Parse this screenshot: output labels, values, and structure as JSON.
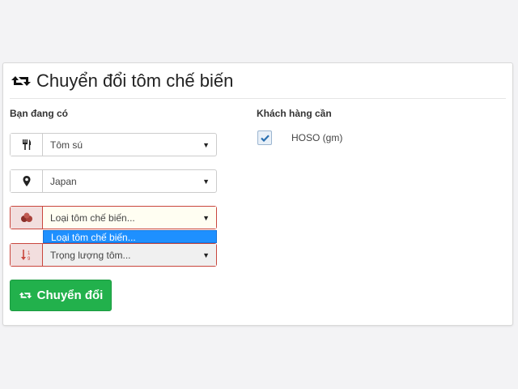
{
  "header": {
    "title": "Chuyển đổi tôm chế biến"
  },
  "left": {
    "section_label": "Bạn đang có",
    "shrimp_select": {
      "value": "Tôm sú",
      "icon": "cutlery-icon"
    },
    "country_select": {
      "value": "Japan",
      "icon": "map-marker-icon"
    },
    "processed_select": {
      "value": "Loại tôm chế biến...",
      "icon": "shrimp-icon",
      "state": "error"
    },
    "dropdown_option": "Loại tôm chế biến...",
    "weight_select": {
      "value": "Trọng lượng tôm...",
      "icon": "sort-numeric-icon",
      "state": "error"
    },
    "convert_button": "Chuyển đổi"
  },
  "right": {
    "section_label": "Khách hàng cần",
    "hoso_checkbox": {
      "label": "HOSO (gm)",
      "checked": true
    }
  },
  "colors": {
    "accent_green": "#22b14c",
    "error_border": "#c9463d",
    "error_addon": "#f2dede",
    "dropdown_highlight": "#1e90ff"
  }
}
